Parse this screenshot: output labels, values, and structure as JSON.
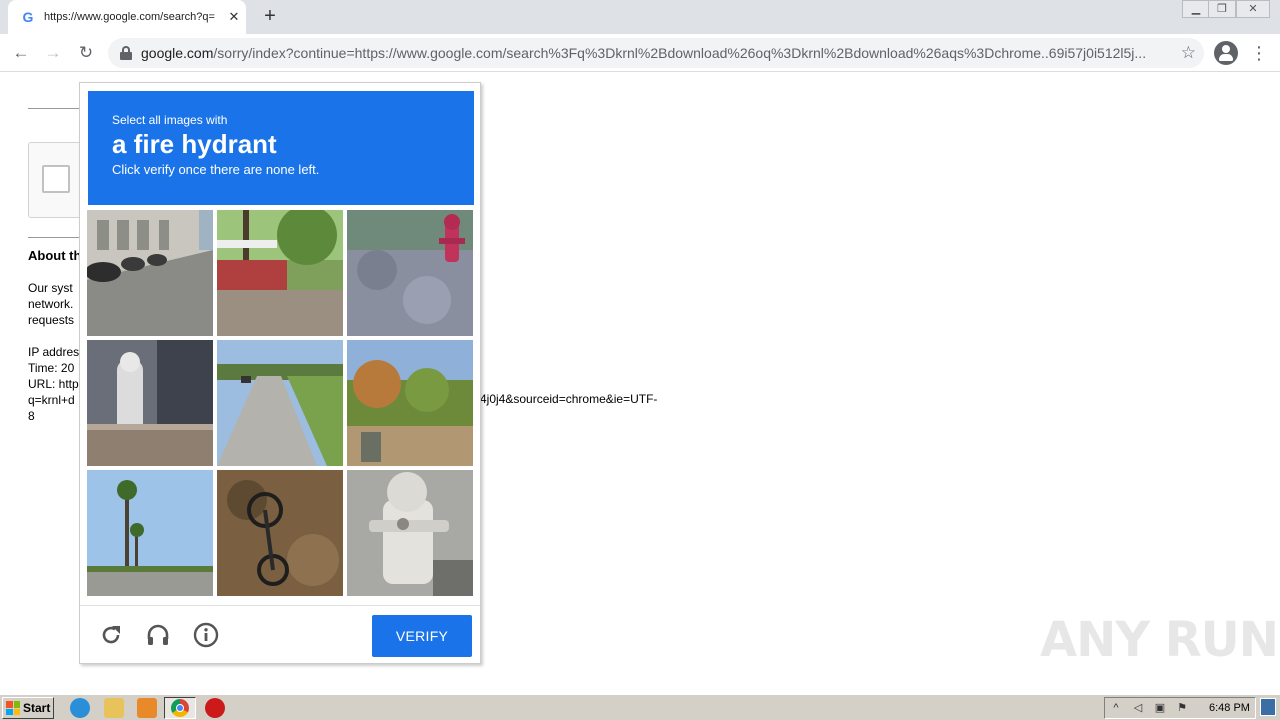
{
  "browser": {
    "tab_title": "https://www.google.com/search?q=",
    "tab_favicon": "G",
    "url_host": "google.com",
    "url_path": "/sorry/index?continue=https://www.google.com/search%3Fq%3Dkrnl%2Bdownload%26oq%3Dkrnl%2Bdownload%26aqs%3Dchrome..69i57j0i512l5j..."
  },
  "page": {
    "about_heading": "About th",
    "para_lines": [
      "Our syst",
      "network.",
      "requests"
    ],
    "info_lines": [
      "IP addres",
      "Time: 20",
      "URL: http",
      "q=krnl+d",
      "8"
    ],
    "url_tail": "4j0j4&sourceid=chrome&ie=UTF-"
  },
  "challenge": {
    "small_label": "Select all images with",
    "target": "a fire hydrant",
    "hint": "Click verify once there are none left.",
    "verify_label": "VERIFY",
    "accent_color": "#1a73e8"
  },
  "watermark": "ANY RUN",
  "taskbar": {
    "start_label": "Start",
    "clock": "6:48 PM"
  }
}
